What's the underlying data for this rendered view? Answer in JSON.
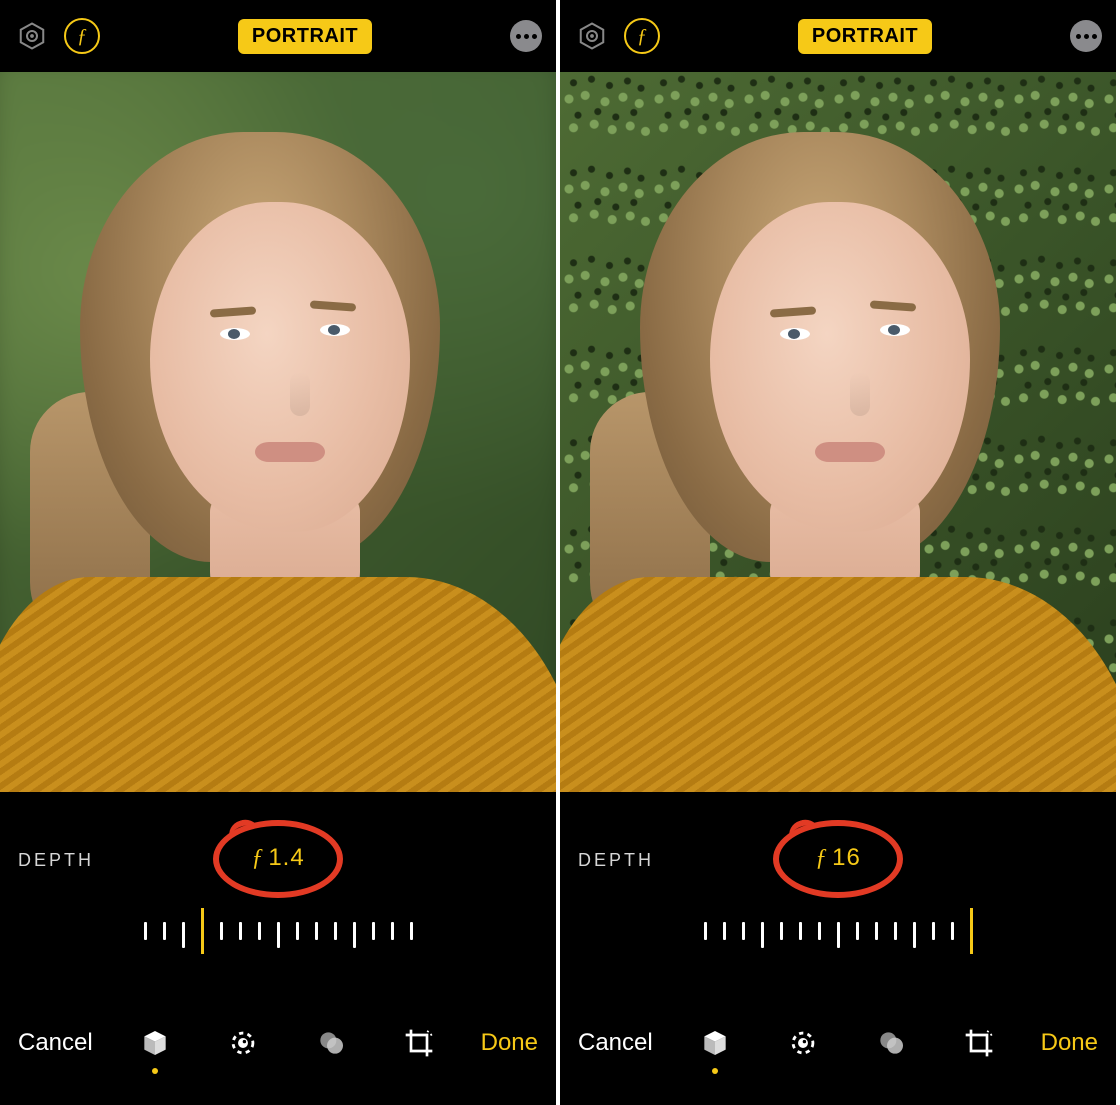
{
  "panes": [
    {
      "mode_label": "PORTRAIT",
      "fstop_glyph": "ƒ",
      "depth": {
        "label": "DEPTH",
        "f_value": "1.4",
        "slider_index": 3,
        "background_blur": true
      },
      "toolbar": {
        "cancel": "Cancel",
        "done": "Done"
      }
    },
    {
      "mode_label": "PORTRAIT",
      "fstop_glyph": "ƒ",
      "depth": {
        "label": "DEPTH",
        "f_value": "16",
        "slider_index": 14,
        "background_blur": false
      },
      "toolbar": {
        "cancel": "Cancel",
        "done": "Done"
      }
    }
  ],
  "colors": {
    "accent": "#f6c917",
    "annotation": "#e23a24"
  },
  "icons": {
    "lighting_hex": "hexagon-icon",
    "fstop": "fstop-icon",
    "more": "ellipsis-icon",
    "cube": "portrait-cube-icon",
    "adjust": "adjust-dial-icon",
    "filters": "filters-circles-icon",
    "crop": "crop-rotate-icon"
  }
}
